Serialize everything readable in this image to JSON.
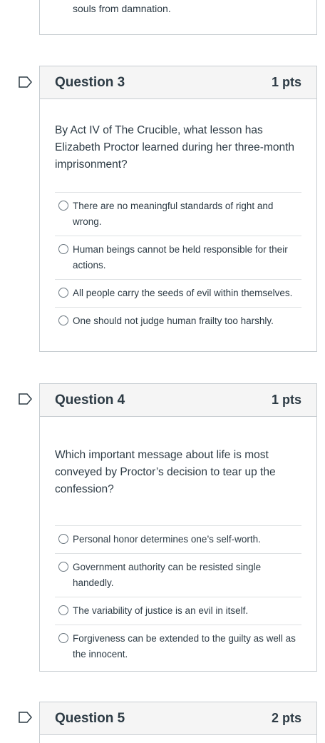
{
  "previous": {
    "tail_text": "souls from damnation."
  },
  "questions": [
    {
      "title": "Question 3",
      "points": "1 pts",
      "text": "By Act IV of The Crucible, what lesson has Elizabeth Proctor learned during her three-month imprisonment?",
      "answers": [
        "There are no meaningful standards of right and wrong.",
        "Human beings cannot be held responsible for their actions.",
        "All people carry the seeds of evil within themselves.",
        "One should not judge human frailty too harshly."
      ]
    },
    {
      "title": "Question 4",
      "points": "1 pts",
      "text": "Which important message about life is most conveyed by Proctor’s decision to tear up the confession?",
      "answers": [
        "Personal honor determines one’s self-worth.",
        "Government authority can be resisted single handedly.",
        "The variability of justice is an evil in itself.",
        "Forgiveness can be extended to the guilty as well as the innocent."
      ]
    },
    {
      "title": "Question 5",
      "points": "2 pts"
    }
  ],
  "colors": {
    "text": "#2d3b45",
    "border": "#c7cdd1",
    "header_bg": "#f5f5f5",
    "divider": "#dfe2e4"
  },
  "icons": {
    "flag": "bookmark-flag-icon",
    "radio": "radio-circle-icon"
  }
}
